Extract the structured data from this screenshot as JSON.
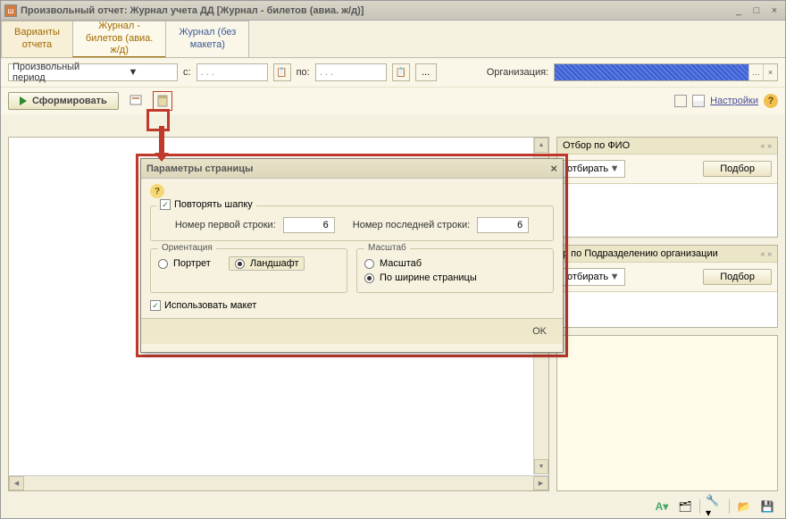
{
  "window": {
    "title": "Произвольный отчет: Журнал учета ДД [Журнал - билетов (авиа. ж/д)]"
  },
  "tabs": {
    "variants": "Варианты\nотчета",
    "journal_tickets": "Журнал -\nбилетов (авиа.\nж/д)",
    "journal_no_layout": "Журнал (без\nмакета)"
  },
  "period_row": {
    "period_value": "Произвольный период",
    "from_label": "с:",
    "from_value": ". . .",
    "to_label": "по:",
    "to_value": ". . .",
    "ellipsis": "...",
    "org_label": "Организация:",
    "org_clear": "...×"
  },
  "actions": {
    "form_label": "Сформировать",
    "settings_label": "Настройки"
  },
  "side": {
    "fio_title": "Отбор по ФИО",
    "dept_title": "р по Подразделению организации",
    "chevrons": "« »",
    "select_value": "отбирать",
    "pick_label": "Подбор"
  },
  "dialog": {
    "title": "Параметры страницы",
    "repeat_header": "Повторять шапку",
    "first_row_label": "Номер первой строки:",
    "first_row_value": "6",
    "last_row_label": "Номер последней строки:",
    "last_row_value": "6",
    "orientation_legend": "Ориентация",
    "portrait": "Портрет",
    "landscape": "Ландшафт",
    "scale_legend": "Масштаб",
    "scale_opt": "Масштаб",
    "page_width": "По ширине страницы",
    "use_layout": "Использовать макет",
    "ok": "OK"
  },
  "icons": {
    "help": "?",
    "close": "×",
    "min": "_",
    "max": "□",
    "up": "▲",
    "down": "▼",
    "left": "◀",
    "right": "▶",
    "check": "✓"
  }
}
